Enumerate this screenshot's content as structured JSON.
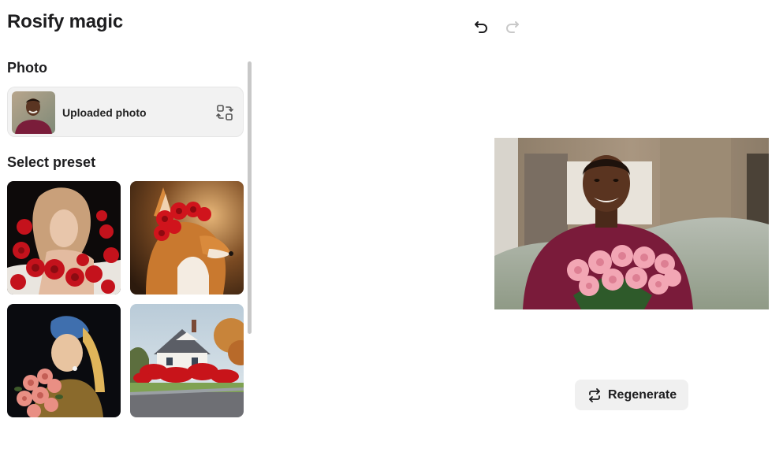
{
  "app": {
    "title": "Rosify magic"
  },
  "toolbar": {
    "undo_icon": "undo-icon",
    "redo_icon": "redo-icon",
    "redo_enabled": false
  },
  "photo_section": {
    "title": "Photo",
    "uploaded_label": "Uploaded photo",
    "swap_icon": "swap-photo-icon"
  },
  "preset_section": {
    "title": "Select preset",
    "presets": [
      {
        "name": "woman-with-roses"
      },
      {
        "name": "corgi-with-rose-crown"
      },
      {
        "name": "girl-with-pearl-earring-roses"
      },
      {
        "name": "house-with-red-roses"
      }
    ]
  },
  "preview": {
    "subject": "man holding pink roses"
  },
  "actions": {
    "regenerate_label": "Regenerate",
    "regenerate_icon": "repeat-icon"
  },
  "colors": {
    "accent_red": "#d8141c",
    "button_bg": "#f0f0f0",
    "card_bg": "#f2f2f2"
  }
}
